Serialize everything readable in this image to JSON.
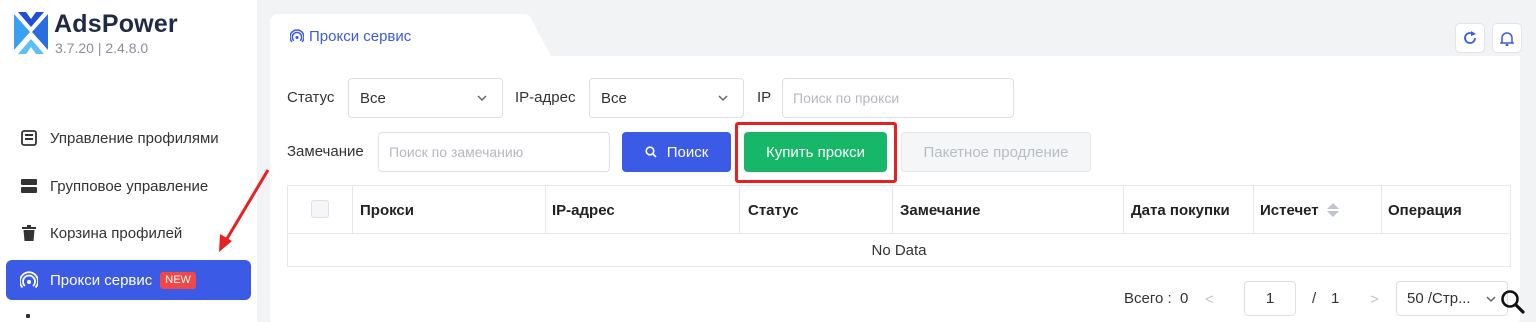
{
  "app": {
    "name": "AdsPower",
    "version": "3.7.20 | 2.4.8.0",
    "brand_color": "#3b5ae6"
  },
  "sidebar": {
    "items": [
      {
        "label": "Управление профилями",
        "icon": "profile-list-icon"
      },
      {
        "label": "Групповое управление",
        "icon": "group-icon"
      },
      {
        "label": "Корзина профилей",
        "icon": "trash-icon"
      },
      {
        "label": "Прокси сервис",
        "icon": "proxy-signal-icon",
        "badge": "NEW",
        "active": true
      }
    ]
  },
  "tab": {
    "label": "Прокси сервис",
    "icon": "proxy-signal-icon"
  },
  "toolbar": {
    "refresh_icon": "refresh-icon",
    "bell_icon": "bell-icon"
  },
  "filters": {
    "status_label": "Статус",
    "status_value": "Все",
    "ip_label": "IP-адрес",
    "ip_value": "Все",
    "ip_search_label": "IP",
    "ip_search_placeholder": "Поиск по прокси",
    "remark_label": "Замечание",
    "remark_placeholder": "Поиск по замечанию",
    "search_button": "Поиск",
    "buy_button": "Купить прокси",
    "renew_button": "Пакетное продление"
  },
  "table": {
    "columns": [
      "Прокси",
      "IP-адрес",
      "Статус",
      "Замечание",
      "Дата покупки",
      "Истечет",
      "Операция"
    ],
    "empty_text": "No Data"
  },
  "pagination": {
    "total_label": "Всего :",
    "total_value": "0",
    "prev": "<",
    "next": ">",
    "current_page": "1",
    "page_separator": "/",
    "total_pages": "1",
    "page_size": "50 /Стр..."
  },
  "colors": {
    "primary": "#3b5ae6",
    "success": "#17b76a",
    "danger": "#f04848",
    "annotation": "#e8201f"
  }
}
